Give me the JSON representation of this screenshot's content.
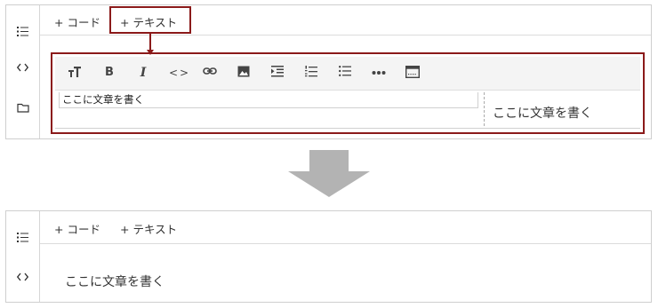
{
  "top_panel": {
    "sidebar_icons": [
      "list-icon",
      "code-brackets-icon",
      "folder-icon"
    ],
    "add_code_label": "+ コード",
    "add_text_label": "+ テキスト",
    "toolbar_icons": [
      "text-size-icon",
      "bold-icon",
      "italic-icon",
      "code-icon",
      "link-icon",
      "image-icon",
      "indent-icon",
      "ordered-list-icon",
      "bullet-list-icon",
      "horizontal-rule-icon",
      "window-icon"
    ],
    "bold_glyph": "B",
    "italic_glyph": "I",
    "code_glyph": "<>",
    "editor_text": "ここに文章を書く",
    "preview_text": "ここに文章を書く"
  },
  "bottom_panel": {
    "sidebar_icons": [
      "list-icon",
      "code-brackets-icon"
    ],
    "add_code_label": "+ コード",
    "add_text_label": "+ テキスト",
    "cell_text": "ここに文章を書く"
  },
  "colors": {
    "highlight": "#8b1a1a",
    "arrow": "#b3b3b3",
    "border": "#cfcfcf",
    "toolbar_bg": "#f4f4f4"
  }
}
